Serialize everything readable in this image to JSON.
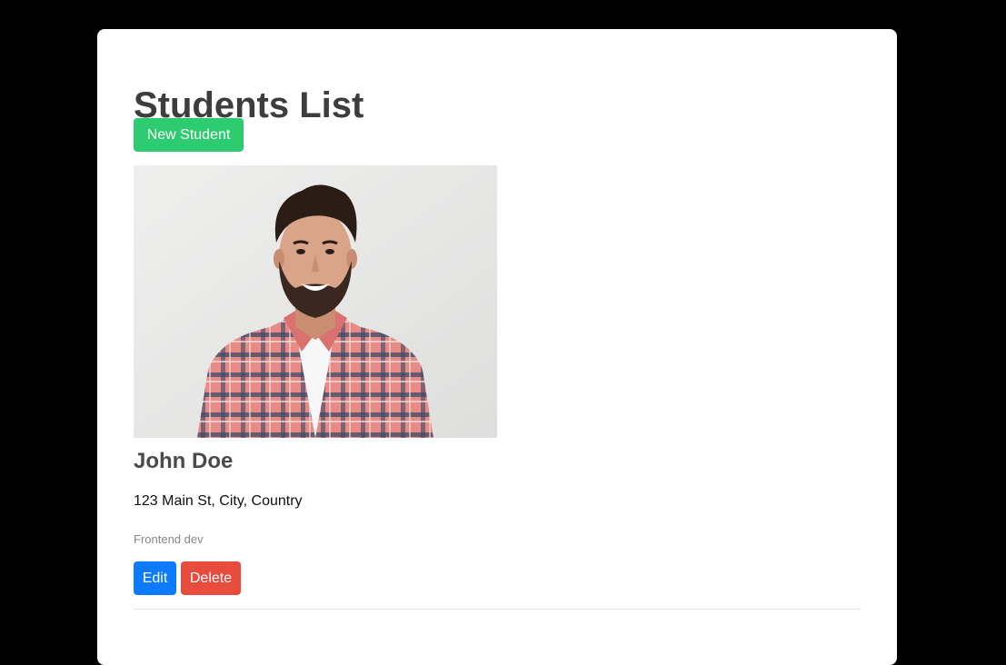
{
  "header": {
    "title": "Students List",
    "new_button_label": "New Student"
  },
  "students": [
    {
      "name": "John Doe",
      "address": "123 Main St, City, Country",
      "role": "Frontend dev",
      "edit_label": "Edit",
      "delete_label": "Delete"
    }
  ],
  "colors": {
    "new_button": "#2ecc71",
    "edit_button": "#0d7bff",
    "delete_button": "#e74c3c"
  }
}
